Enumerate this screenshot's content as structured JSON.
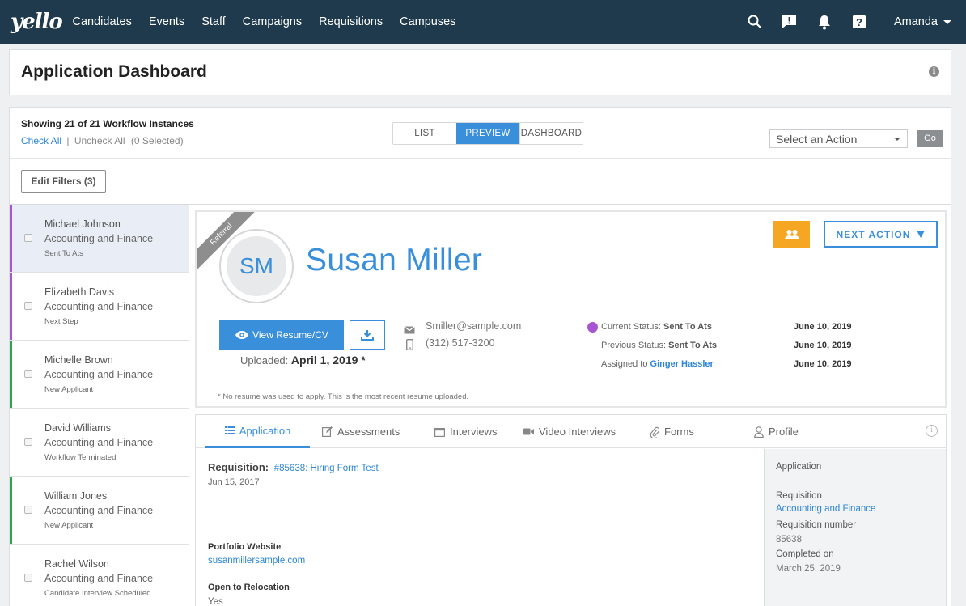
{
  "app": {
    "logo": "yello"
  },
  "nav": {
    "links": [
      "Candidates",
      "Events",
      "Staff",
      "Campaigns",
      "Requisitions",
      "Campuses"
    ],
    "user": "Amanda"
  },
  "page": {
    "title": "Application Dashboard"
  },
  "toolbar": {
    "showing": "Showing 21 of 21 Workflow Instances",
    "check_all": "Check All",
    "separator": "|",
    "uncheck_all": "Uncheck All",
    "selected_count": "(0 Selected)",
    "view_modes": [
      "LIST",
      "PREVIEW",
      "DASHBOARD"
    ],
    "active_view": "PREVIEW",
    "action_select": "Select an Action",
    "go": "Go",
    "edit_filters": "Edit Filters (3)"
  },
  "candidates": [
    {
      "name": "Michael Johnson",
      "dept": "Accounting and Finance",
      "status": "Sent To Ats",
      "color": "#a855d4",
      "selected": true
    },
    {
      "name": "Elizabeth Davis",
      "dept": "Accounting and Finance",
      "status": "Next Step",
      "color": "#a855d4",
      "selected": false
    },
    {
      "name": "Michelle Brown",
      "dept": "Accounting and Finance",
      "status": "New Applicant",
      "color": "#2ea44f",
      "selected": false
    },
    {
      "name": "David Williams",
      "dept": "Accounting and Finance",
      "status": "Workflow Terminated",
      "color": "#ffffff",
      "selected": false
    },
    {
      "name": "William Jones",
      "dept": "Accounting and Finance",
      "status": "New Applicant",
      "color": "#2ea44f",
      "selected": false
    },
    {
      "name": "Rachel Wilson",
      "dept": "Accounting and Finance",
      "status": "Candidate Interview Scheduled",
      "color": "#ffffff",
      "selected": false
    }
  ],
  "profile": {
    "ribbon": "Referral",
    "initials": "SM",
    "name": "Susan Miller",
    "next_action": "NEXT ACTION",
    "view_resume": "View Resume/CV",
    "uploaded_label": "Uploaded:",
    "uploaded_date": "April 1, 2019 *",
    "email": "Smiller@sample.com",
    "phone": "(312) 517-3200",
    "current_status_label": "Current Status:",
    "current_status": "Sent To Ats",
    "previous_status_label": "Previous Status:",
    "previous_status": "Sent To Ats",
    "assigned_label": "Assigned to",
    "assigned_to": "Ginger Hassler",
    "dates": [
      "June 10, 2019",
      "June 10, 2019",
      "June 10, 2019"
    ],
    "footnote": "* No resume was used to apply. This is the most recent resume uploaded.",
    "status_color": "#a855d4"
  },
  "tabs": {
    "items": [
      "Application",
      "Assessments",
      "Interviews",
      "Video Interviews",
      "Forms",
      "Profile"
    ],
    "active": "Application"
  },
  "application": {
    "requisition_label": "Requisition:",
    "requisition_link": "#85638: Hiring Form Test",
    "requisition_date": "Jun 15, 2017",
    "portfolio_label": "Portfolio Website",
    "portfolio_value": "susanmillersample.com",
    "relocation_label": "Open to Relocation",
    "relocation_value": "Yes"
  },
  "sidebar": {
    "heading": "Application",
    "requisition_label": "Requisition",
    "requisition_value": "Accounting and Finance",
    "req_number_label": "Requisition number",
    "req_number_value": "85638",
    "completed_label": "Completed on",
    "completed_value": "March 25, 2019"
  },
  "colors": {
    "nav_bg": "#1e3a4c",
    "accent": "#3a8fdb",
    "orange": "#f5a623"
  }
}
